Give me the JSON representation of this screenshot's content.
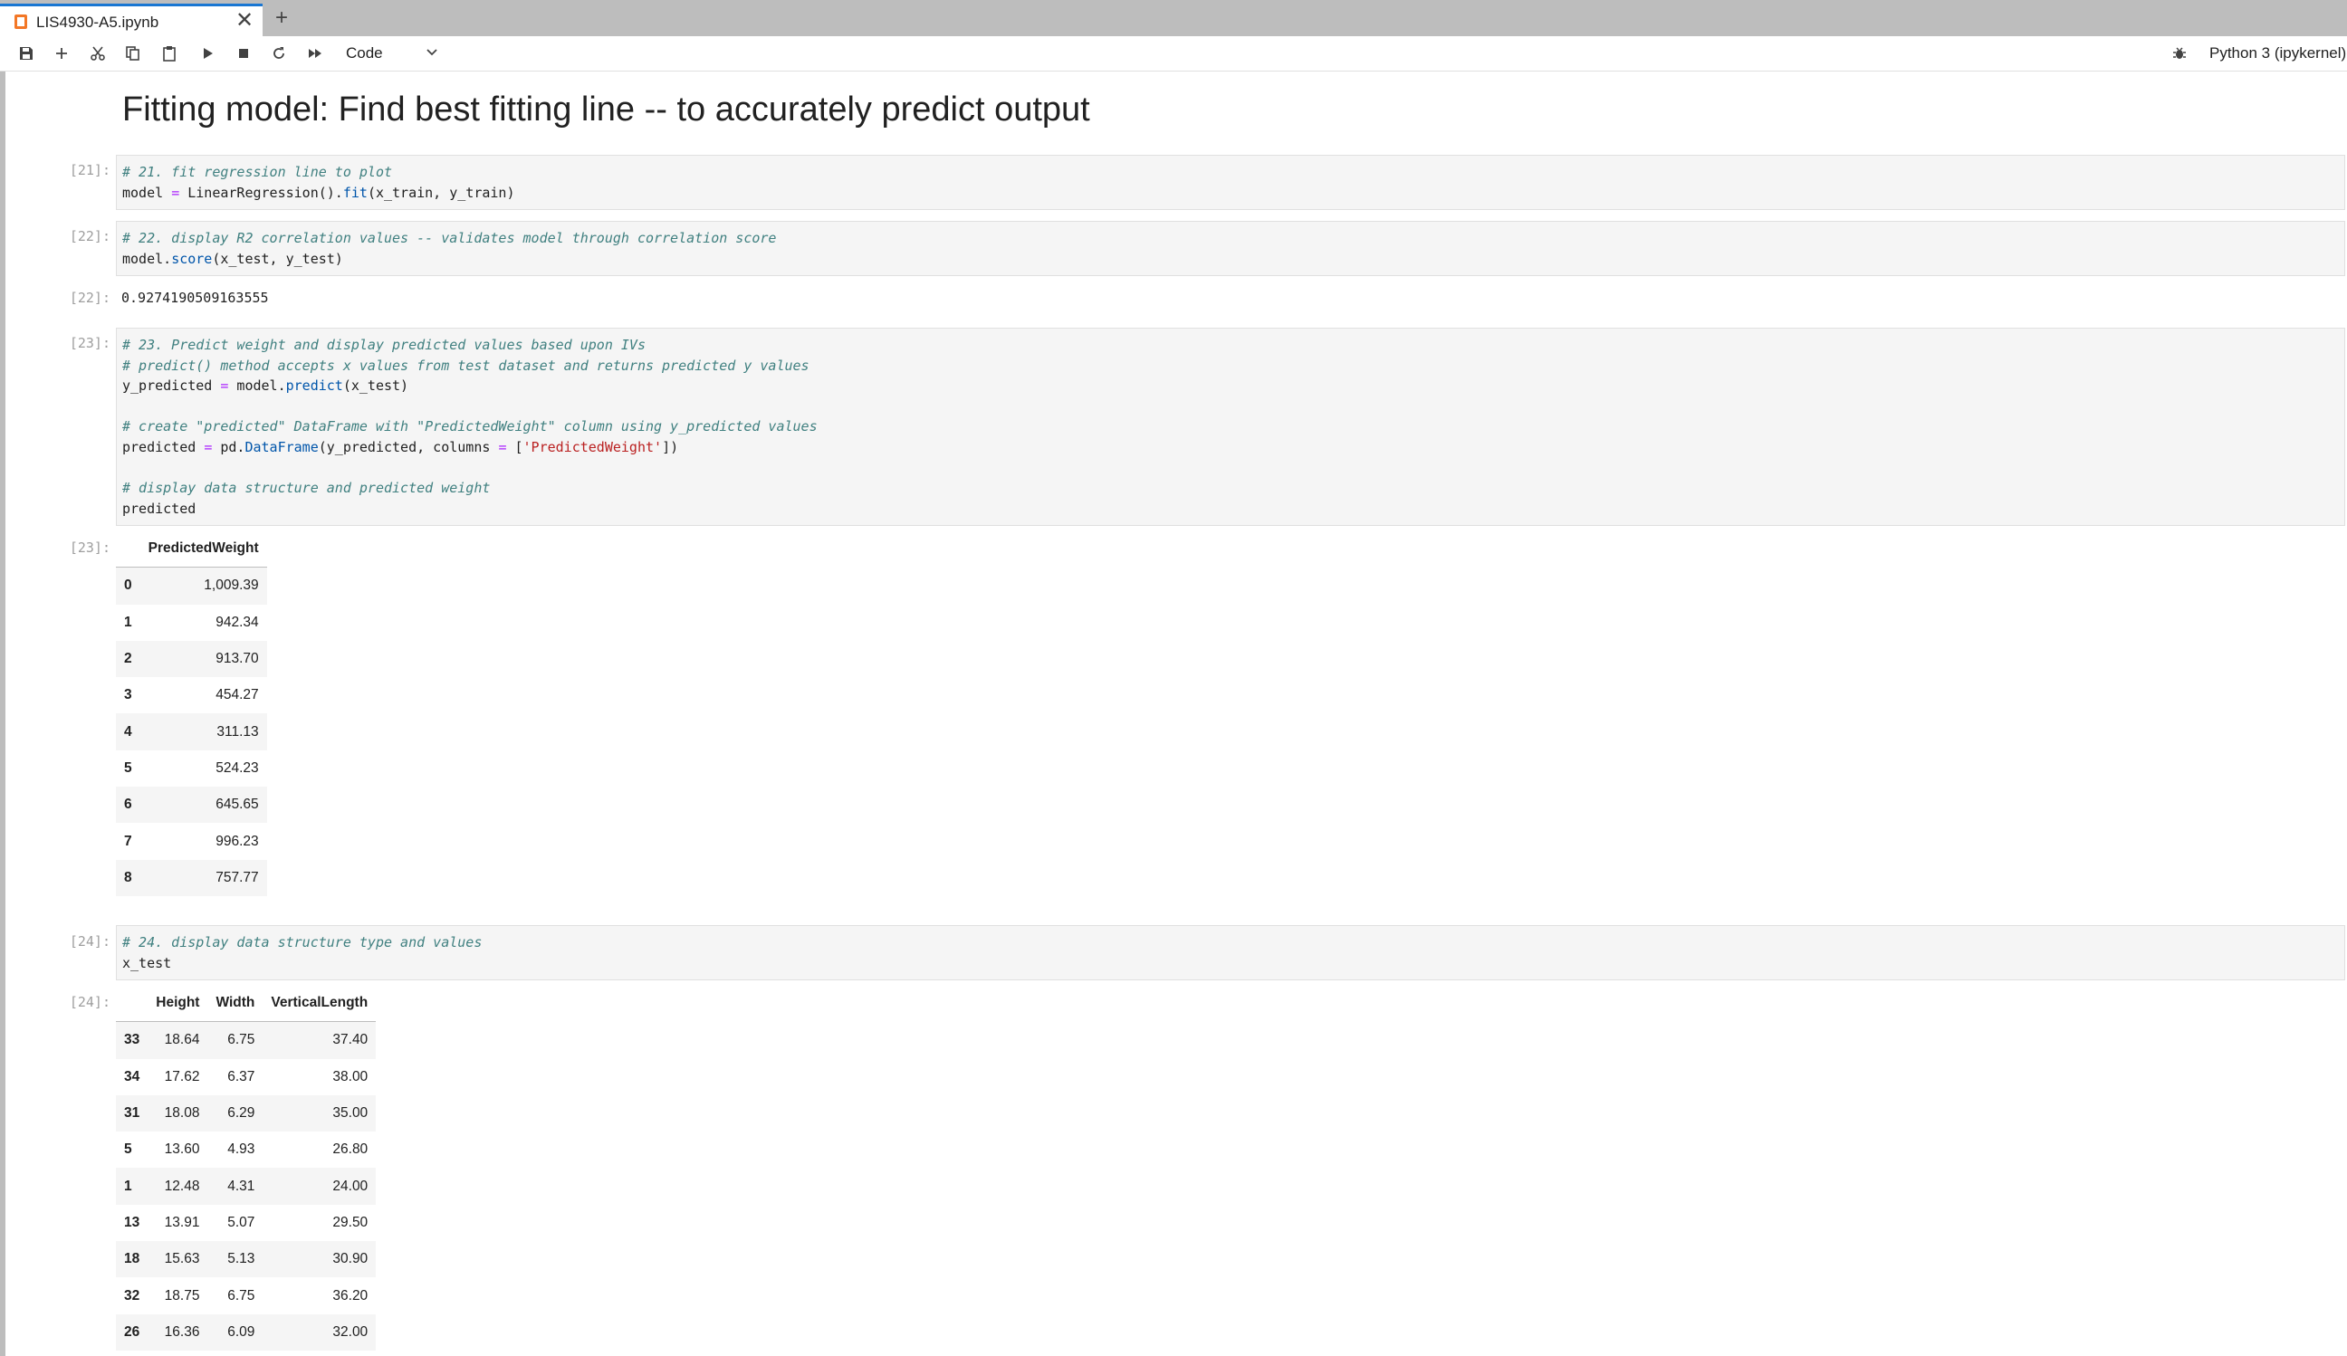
{
  "tab": {
    "title": "LIS4930-A5.ipynb",
    "close": "✕",
    "add": "+"
  },
  "toolbar": {
    "cell_type": "Code",
    "kernel": "Python 3 (ipykernel)"
  },
  "heading": "Fitting model: Find best fitting line -- to accurately predict output",
  "cells": [
    {
      "prompt": "[21]:",
      "lines": [
        [
          [
            "cm",
            "# 21. fit regression line to plot"
          ]
        ],
        [
          [
            "",
            "model "
          ],
          [
            "op",
            "="
          ],
          [
            "",
            " LinearRegression()."
          ],
          [
            "fn",
            "fit"
          ],
          [
            "",
            "(x_train, y_train)"
          ]
        ]
      ]
    },
    {
      "prompt": "[22]:",
      "lines": [
        [
          [
            "cm",
            "# 22. display R2 correlation values -- validates model through correlation score"
          ]
        ],
        [
          [
            "",
            "model."
          ],
          [
            "fn",
            "score"
          ],
          [
            "",
            "(x_test, y_test)"
          ]
        ]
      ]
    },
    {
      "prompt": "[23]:",
      "lines": [
        [
          [
            "cm",
            "# 23. Predict weight and display predicted values based upon IVs"
          ]
        ],
        [
          [
            "cm",
            "# predict() method accepts x values from test dataset and returns predicted y values"
          ]
        ],
        [
          [
            "",
            "y_predicted "
          ],
          [
            "op",
            "="
          ],
          [
            "",
            " model."
          ],
          [
            "fn",
            "predict"
          ],
          [
            "",
            "(x_test)"
          ]
        ],
        [
          [
            "",
            ""
          ]
        ],
        [
          [
            "cm",
            "# create \"predicted\" DataFrame with \"PredictedWeight\" column using y_predicted values"
          ]
        ],
        [
          [
            "",
            "predicted "
          ],
          [
            "op",
            "="
          ],
          [
            "",
            " pd."
          ],
          [
            "fn",
            "DataFrame"
          ],
          [
            "",
            "(y_predicted, columns "
          ],
          [
            "op",
            "="
          ],
          [
            "",
            " ["
          ],
          [
            "st",
            "'PredictedWeight'"
          ],
          [
            "",
            "])"
          ]
        ],
        [
          [
            "",
            ""
          ]
        ],
        [
          [
            "cm",
            "# display data structure and predicted weight"
          ]
        ],
        [
          [
            "",
            "predicted"
          ]
        ]
      ]
    },
    {
      "prompt": "[24]:",
      "lines": [
        [
          [
            "cm",
            "# 24. display data structure type and values"
          ]
        ],
        [
          [
            "",
            "x_test"
          ]
        ]
      ]
    }
  ],
  "outputs": {
    "out22": {
      "prompt": "[22]:",
      "text": "0.9274190509163555"
    },
    "out23": {
      "prompt": "[23]:",
      "columns": [
        "",
        "PredictedWeight"
      ],
      "rows": [
        [
          "0",
          "1,009.39"
        ],
        [
          "1",
          "942.34"
        ],
        [
          "2",
          "913.70"
        ],
        [
          "3",
          "454.27"
        ],
        [
          "4",
          "311.13"
        ],
        [
          "5",
          "524.23"
        ],
        [
          "6",
          "645.65"
        ],
        [
          "7",
          "996.23"
        ],
        [
          "8",
          "757.77"
        ]
      ]
    },
    "out24": {
      "prompt": "[24]:",
      "columns": [
        "",
        "Height",
        "Width",
        "VerticalLength"
      ],
      "rows": [
        [
          "33",
          "18.64",
          "6.75",
          "37.40"
        ],
        [
          "34",
          "17.62",
          "6.37",
          "38.00"
        ],
        [
          "31",
          "18.08",
          "6.29",
          "35.00"
        ],
        [
          "5",
          "13.60",
          "4.93",
          "26.80"
        ],
        [
          "1",
          "12.48",
          "4.31",
          "24.00"
        ],
        [
          "13",
          "13.91",
          "5.07",
          "29.50"
        ],
        [
          "18",
          "15.63",
          "5.13",
          "30.90"
        ],
        [
          "32",
          "18.75",
          "6.75",
          "36.20"
        ],
        [
          "26",
          "16.36",
          "6.09",
          "32.00"
        ]
      ]
    }
  }
}
